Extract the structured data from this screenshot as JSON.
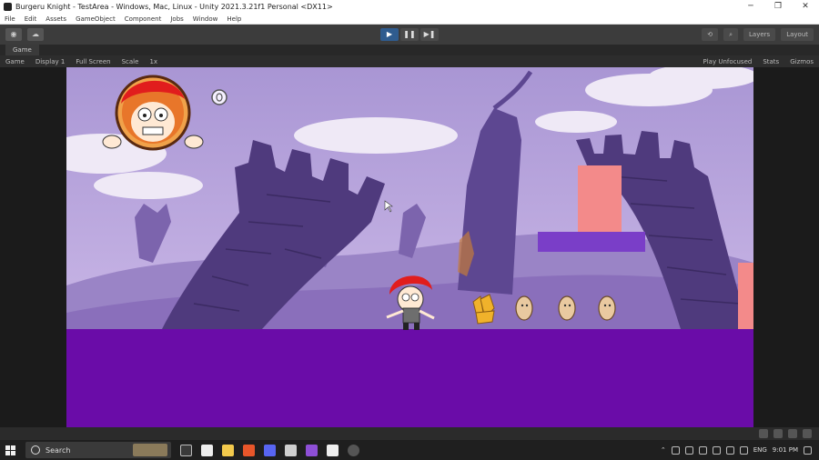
{
  "window": {
    "title": "Burgeru Knight - TestArea - Windows, Mac, Linux - Unity 2021.3.21f1 Personal <DX11>",
    "controls": [
      "─",
      "❐",
      "✕"
    ]
  },
  "menu": [
    "File",
    "Edit",
    "Assets",
    "GameObject",
    "Component",
    "Jobs",
    "Window",
    "Help"
  ],
  "toolbar": {
    "play": "▶",
    "pause": "❚❚",
    "step": "▶❚",
    "layers_label": "Layers",
    "layout_label": "Layout"
  },
  "tab": {
    "label": "Game"
  },
  "gamebar": {
    "display": "Game",
    "display_select": "Display 1",
    "aspect": "Full Screen",
    "scale_label": "Scale",
    "scale_value": "1x",
    "play_mode": "Play Unfocused",
    "stats": "Stats",
    "gizmos": "Gizmos"
  },
  "taskbar": {
    "search_placeholder": "Search",
    "lang": "ENG",
    "time": "9:01 PM"
  },
  "colors": {
    "sky": "#b6a2d8",
    "ground": "#6a0ca8",
    "platform": "#7a3ec8",
    "pink_block": "#f38a8a"
  }
}
